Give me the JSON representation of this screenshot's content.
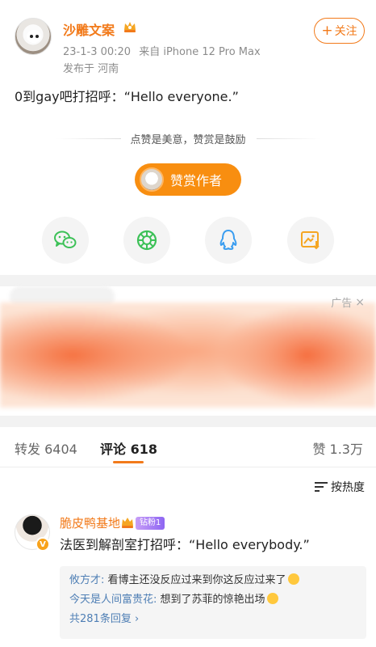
{
  "post": {
    "username": "沙雕文案",
    "date": "23-1-3 00:20",
    "source": "来自 iPhone 12 Pro Max",
    "location": "发布于 河南",
    "follow_label": "关注",
    "text": "0到gay吧打招呼：“Hello everyone.”"
  },
  "reward": {
    "slogan": "点赞是美意，赞赏是鼓励",
    "button_label": "赞赏作者"
  },
  "share": {
    "items": [
      "wechat-icon",
      "moments-icon",
      "qq-icon",
      "save-image-icon"
    ],
    "colors": {
      "wechat": "#3cc157",
      "moments": "#3cc157",
      "qq": "#3a9df0",
      "save": "#f5a623"
    }
  },
  "ad": {
    "label": "广告",
    "close": "×"
  },
  "tabs": {
    "repost": "转发 6404",
    "comments": "评论 618",
    "likes": "赞 1.3万"
  },
  "sort_label": "按热度",
  "comment": {
    "username": "脆皮鸭基地",
    "badge": "钻粉1",
    "text": "法医到解剖室打招呼：“Hello everybody.”",
    "replies": [
      {
        "who": "攸方才:",
        "text": "看博主还没反应过来到你这反应过来了"
      },
      {
        "who": "今天是人间富贵花:",
        "text": "想到了苏菲的惊艳出场"
      }
    ],
    "more": "共281条回复 ›"
  },
  "colors": {
    "accent": "#f27a1a",
    "reward": "#f88e10",
    "link": "#4f7fb5"
  }
}
